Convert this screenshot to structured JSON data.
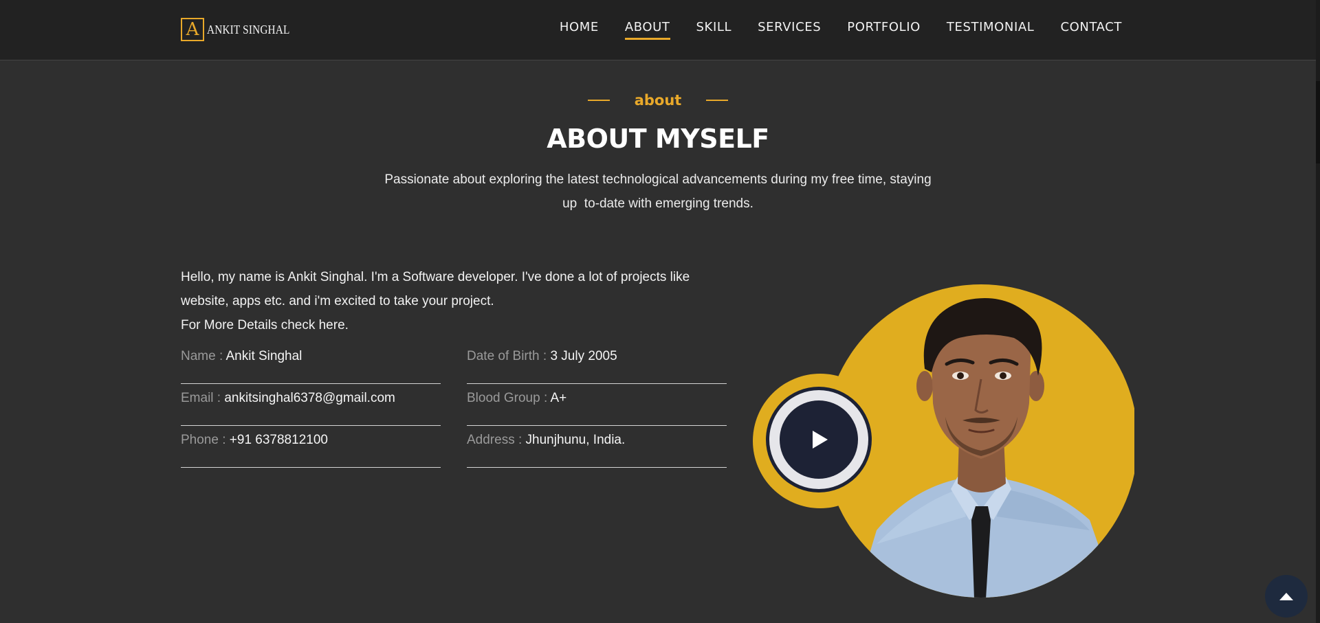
{
  "header": {
    "logo_letter": "A",
    "logo_text": "ANKIT SINGHAL",
    "nav": [
      {
        "label": "HOME"
      },
      {
        "label": "ABOUT"
      },
      {
        "label": "SKILL"
      },
      {
        "label": "SERVICES"
      },
      {
        "label": "PORTFOLIO"
      },
      {
        "label": "TESTIMONIAL"
      },
      {
        "label": "CONTACT"
      }
    ],
    "active_nav": "ABOUT"
  },
  "about": {
    "eyebrow": "about",
    "title": "ABOUT MYSELF",
    "subtitle_line1": "Passionate about exploring the latest technological advancements during my free time, staying",
    "subtitle_line2": "up  to-date with emerging trends.",
    "intro_line1": "Hello, my name is Ankit Singhal. I'm a Software developer. I've done a lot of projects like",
    "intro_line2": "website, apps etc. and i'm excited to take your project.",
    "intro_line3": "For More Details check here.",
    "info": {
      "name_label": "Name : ",
      "name_value": "Ankit Singhal",
      "dob_label": "Date of Birth : ",
      "dob_value": "3 July 2005",
      "email_label": "Email : ",
      "email_value": "ankitsinghal6378@gmail.com",
      "blood_label": "Blood Group : ",
      "blood_value": "A+",
      "phone_label": "Phone : ",
      "phone_value": "+91 6378812100",
      "address_label": "Address : ",
      "address_value": "Jhunjhunu, India."
    }
  },
  "icons": {
    "play": "play-icon",
    "back_to_top": "chevron-up-icon"
  },
  "colors": {
    "accent": "#e9a92a",
    "photo_bg": "#e0ad1f",
    "page_bg": "#2f2f2f",
    "nav_bg": "#222222",
    "play_dark": "#1d2235",
    "to_top_bg": "#1e2a3e"
  }
}
